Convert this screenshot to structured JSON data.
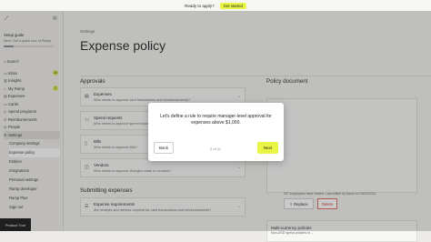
{
  "banner": {
    "text": "Ready to apply?",
    "cta": "Get started"
  },
  "sidebar": {
    "logo": "⟋",
    "setup_title": "Setup guide",
    "setup_subtitle": "Next: Get a quick tour of Ramp",
    "setup_progress": 0.2,
    "search": "Search",
    "items": [
      {
        "label": "Inbox",
        "icon": "inbox-icon",
        "badge": "16"
      },
      {
        "label": "Insights",
        "icon": "chart-icon",
        "badge": ""
      },
      {
        "label": "My Ramp",
        "icon": "user-icon",
        "badge": "2"
      },
      {
        "label": "Expenses",
        "icon": "receipt-icon",
        "badge": ""
      },
      {
        "label": "Cards",
        "icon": "card-icon",
        "badge": ""
      },
      {
        "label": "Spend programs",
        "icon": "program-icon",
        "badge": ""
      },
      {
        "label": "Reimbursements",
        "icon": "reimburse-icon",
        "badge": ""
      },
      {
        "label": "People",
        "icon": "people-icon",
        "badge": ""
      },
      {
        "label": "Settings",
        "icon": "gear-icon",
        "badge": ""
      }
    ],
    "sub_items": [
      {
        "label": "Company settings"
      },
      {
        "label": "Expense policy"
      },
      {
        "label": "Entities"
      },
      {
        "label": "Integrations"
      },
      {
        "label": "Personal settings"
      },
      {
        "label": "Ramp developer"
      },
      {
        "label": "Ramp Plus"
      },
      {
        "label": "Sign out"
      }
    ],
    "tour_label": "Product Tour"
  },
  "main": {
    "breadcrumb": "Settings",
    "title": "Expense policy",
    "approvals_heading": "Approvals",
    "approval_cards": [
      {
        "title": "Expenses",
        "subtitle": "Who needs to approve card transactions and reimbursements?"
      },
      {
        "title": "Spend requests",
        "subtitle": "Who needs to approve spend requests?"
      },
      {
        "title": "Bills",
        "subtitle": "Who needs to approve bills?"
      },
      {
        "title": "Vendors",
        "subtitle": "Who needs to approve changes made to vendors?"
      }
    ],
    "submitting_heading": "Submitting expenses",
    "submitting_cards": [
      {
        "title": "Expense requirements",
        "subtitle": "Are receipts and memos required for card transactions and reimbursements?"
      }
    ],
    "policy_doc_heading": "Policy document",
    "policy_doc_note": "597 employees have viewed. Last edited by David on 03/01/2024",
    "replace_label": "Replace",
    "delete_label": "Delete",
    "multi_title": "Multi-currency policies",
    "multi_subtitle": "Non-USD spend policies in..."
  },
  "modal": {
    "text": "Let's define a rule to require manager-level approval for expenses above $1,000.",
    "back_label": "Back",
    "step_label": "2 of 11",
    "next_label": "Next"
  }
}
